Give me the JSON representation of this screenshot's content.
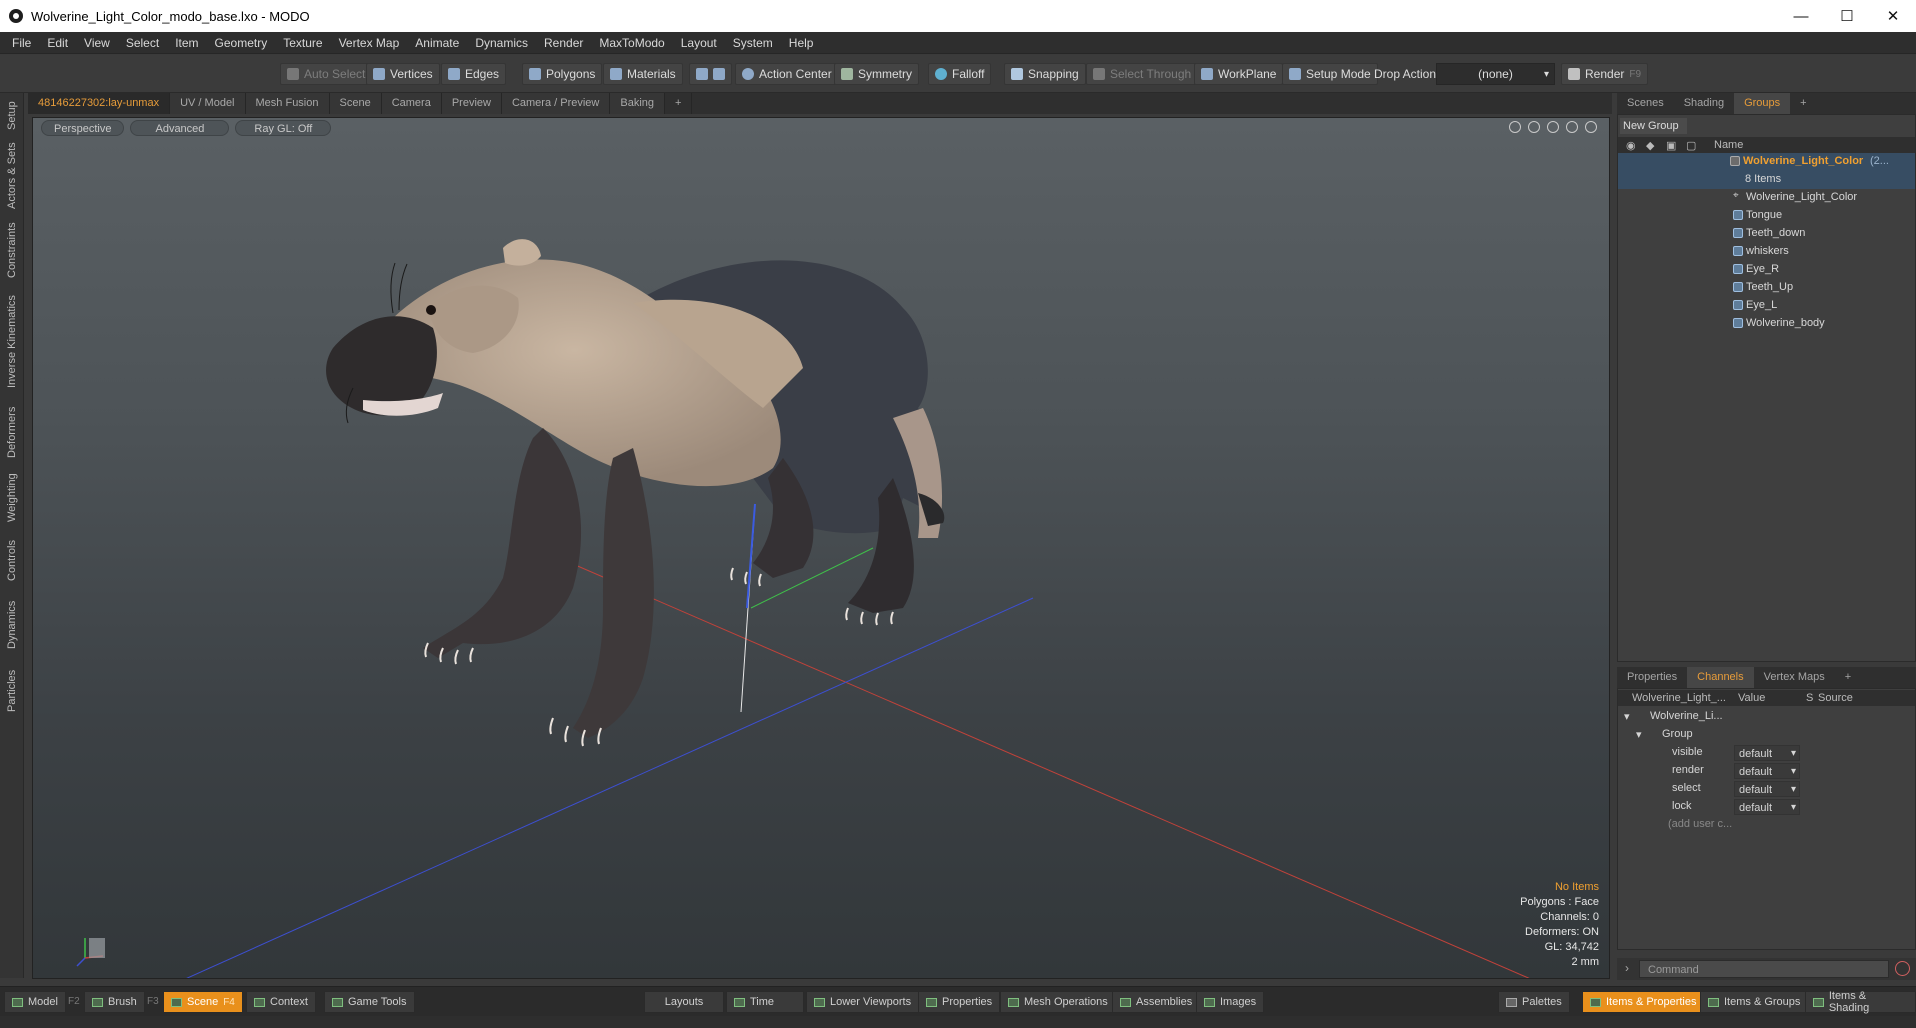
{
  "window": {
    "title": "Wolverine_Light_Color_modo_base.lxo - MODO",
    "minimize": "—",
    "maximize": "☐",
    "close": "✕"
  },
  "menu": [
    "File",
    "Edit",
    "View",
    "Select",
    "Item",
    "Geometry",
    "Texture",
    "Vertex Map",
    "Animate",
    "Dynamics",
    "Render",
    "MaxToModo",
    "Layout",
    "System",
    "Help"
  ],
  "toolbar": {
    "auto_select": "Auto Select",
    "vertices": "Vertices",
    "edges": "Edges",
    "polygons": "Polygons",
    "materials": "Materials",
    "action_center": "Action Center",
    "symmetry": "Symmetry",
    "falloff": "Falloff",
    "snapping": "Snapping",
    "select_through": "Select Through",
    "workplane": "WorkPlane",
    "setup_mode": "Setup Mode",
    "drop_action": "Drop Action",
    "drop_value": "(none)",
    "render": "Render",
    "render_key": "F9"
  },
  "left_tabs": [
    "Setup",
    "Actors & Sets",
    "Constraints",
    "Inverse Kinematics",
    "Deformers",
    "Weighting",
    "Controls",
    "Dynamics",
    "Particles"
  ],
  "viewport_tabs": [
    "48146227302:lay-unmax",
    "UV / Model",
    "Mesh Fusion",
    "Scene",
    "Camera",
    "Preview",
    "Camera / Preview",
    "Baking",
    "+"
  ],
  "viewport": {
    "view": "Perspective",
    "shading": "Advanced",
    "raygl": "Ray GL: Off",
    "hud": {
      "items": "No Items",
      "polygons": "Polygons : Face",
      "channels": "Channels: 0",
      "deformers": "Deformers: ON",
      "gl": "GL: 34,742",
      "scale": "2 mm"
    }
  },
  "right_tabs": [
    "Scenes",
    "Shading",
    "Groups",
    "+"
  ],
  "groups": {
    "new_group": "New Group",
    "col_name": "Name",
    "root": "Wolverine_Light_Color",
    "root_suffix": "(2...",
    "count": "8 Items",
    "items": [
      "Wolverine_Light_Color",
      "Tongue",
      "Teeth_down",
      "whiskers",
      "Eye_R",
      "Teeth_Up",
      "Eye_L",
      "Wolverine_body"
    ]
  },
  "prop_tabs": [
    "Properties",
    "Channels",
    "Vertex Maps",
    "+"
  ],
  "channels": {
    "col_item": "Wolverine_Light_...",
    "col_value": "Value",
    "col_s": "S",
    "col_source": "Source",
    "item": "Wolverine_Li...",
    "group": "Group",
    "rows": [
      {
        "name": "visible",
        "value": "default"
      },
      {
        "name": "render",
        "value": "default"
      },
      {
        "name": "select",
        "value": "default"
      },
      {
        "name": "lock",
        "value": "default"
      }
    ],
    "add_user": "(add user c..."
  },
  "command": {
    "placeholder": "Command"
  },
  "bottom": {
    "model": "Model",
    "model_key": "F2",
    "brush": "Brush",
    "brush_key": "F3",
    "scene": "Scene",
    "scene_key": "F4",
    "context": "Context",
    "game_tools": "Game Tools",
    "layouts": "Layouts",
    "time": "Time",
    "lower_viewports": "Lower Viewports",
    "properties": "Properties",
    "mesh_operations": "Mesh Operations",
    "assemblies": "Assemblies",
    "images": "Images",
    "palettes": "Palettes",
    "items_properties": "Items & Properties",
    "items_groups": "Items & Groups",
    "items_shading": "Items & Shading"
  },
  "colors": {
    "accent": "#e9901c",
    "selection": "#374d63",
    "viewport_top": "#5a6064",
    "viewport_bottom": "#32373a"
  }
}
